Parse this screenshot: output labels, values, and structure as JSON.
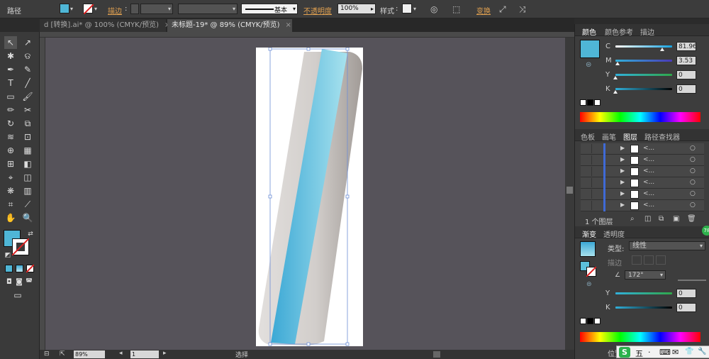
{
  "control_bar": {
    "path_label": "路径",
    "stroke_label": "描边",
    "stroke_style_label": "基本",
    "opacity_label": "不透明度",
    "opacity_value": "100%",
    "style_label": "样式",
    "transform_label": "变换",
    "fill_color": "#4fb6d6"
  },
  "tabs": [
    {
      "label": "d [转换].ai* @ 100% (CMYK/预览)",
      "close": "×"
    },
    {
      "label": "未标题-19* @ 89% (CMYK/预览)",
      "close": "×"
    }
  ],
  "status_bar": {
    "zoom": "89%",
    "page": "1",
    "mode": "选择"
  },
  "color_panel": {
    "tabs": [
      "颜色",
      "颜色参考",
      "描边"
    ],
    "channels": [
      {
        "label": "C",
        "value": "81.96",
        "level": 0.82
      },
      {
        "label": "M",
        "value": "3.53",
        "level": 0.04
      },
      {
        "label": "Y",
        "value": "0",
        "level": 0
      },
      {
        "label": "K",
        "value": "0",
        "level": 0
      }
    ]
  },
  "layers_panel": {
    "tabs": [
      "色板",
      "画笔",
      "图层",
      "路径查找器"
    ],
    "rows": [
      "<...",
      "<...",
      "<...",
      "<...",
      "<...",
      "<..."
    ],
    "footer": "1 个图层"
  },
  "gradient_panel": {
    "tabs": [
      "渐变",
      "透明度"
    ],
    "type_label": "类型:",
    "type_value": "线性",
    "stroke_label": "描边",
    "angle_value": "172°",
    "channels": [
      {
        "label": "Y",
        "value": "0"
      },
      {
        "label": "K",
        "value": "0"
      }
    ],
    "position_label": "位置"
  },
  "ime_bar": {
    "logo": "S",
    "chars": [
      "五",
      "·",
      "⌨",
      "✉",
      "👕",
      "🔧"
    ]
  },
  "badge": "78"
}
